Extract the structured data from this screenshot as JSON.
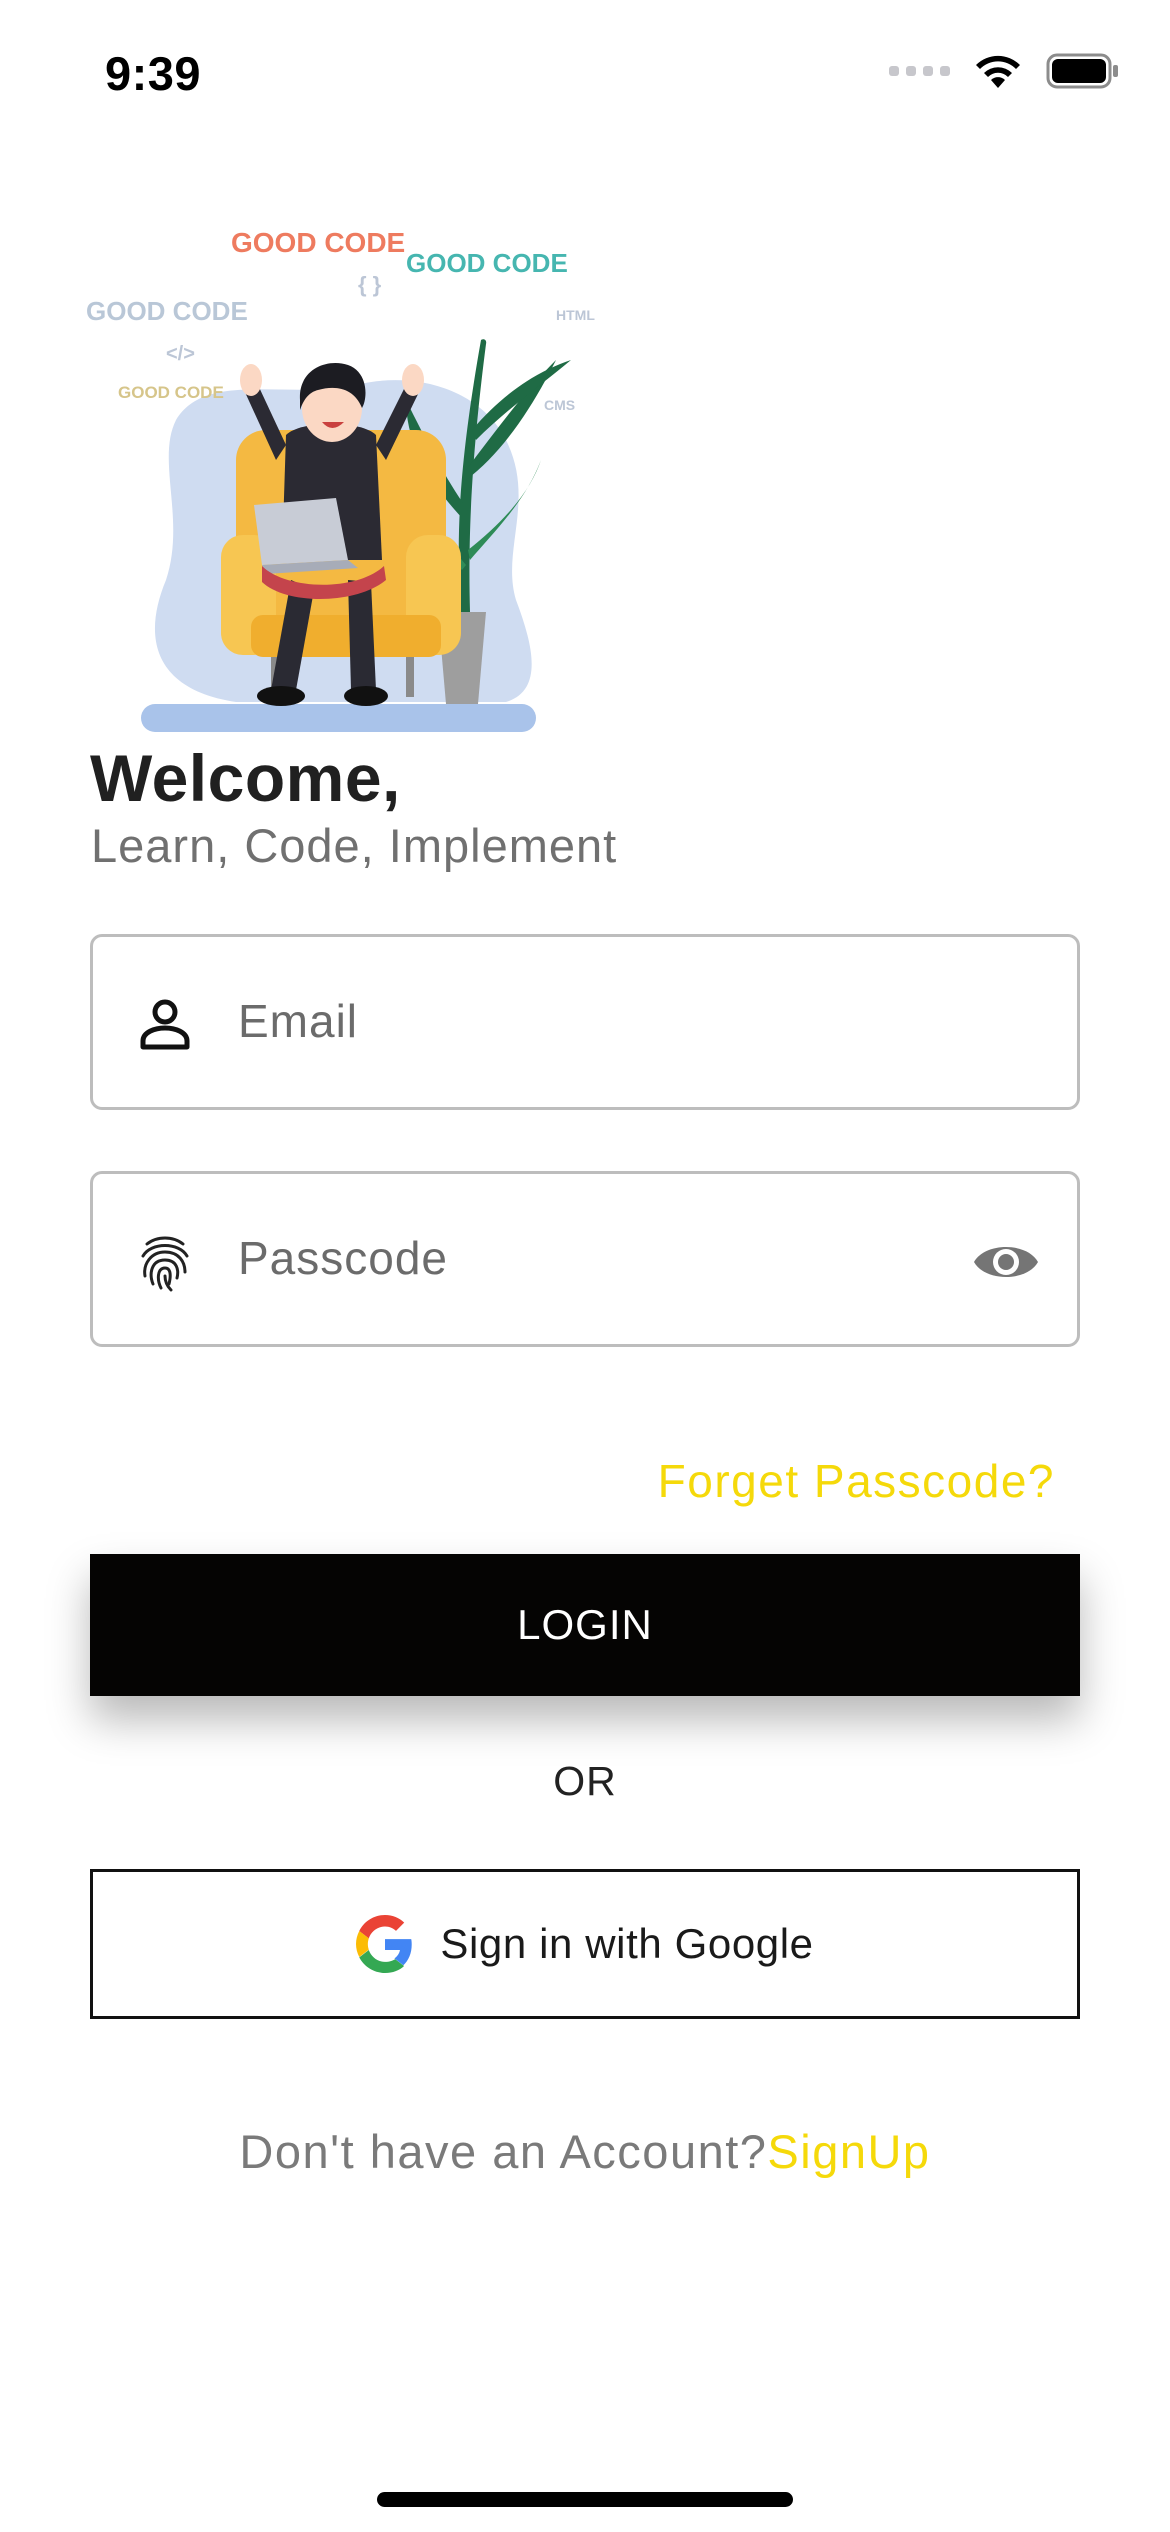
{
  "status_bar": {
    "time": "9:39"
  },
  "illustration": {
    "alt": "person-with-laptop-illustration",
    "code_words": [
      "GOOD CODE",
      "GOOD CODE",
      "GOOD CODE",
      "GOOD CODE",
      "{ }",
      "</>",
      "HTML",
      "CMS"
    ]
  },
  "header": {
    "title": "Welcome,",
    "subtitle": "Learn, Code, Implement"
  },
  "form": {
    "email_placeholder": "Email",
    "passcode_placeholder": "Passcode",
    "forgot_label": "Forget Passcode?",
    "login_label": "LOGIN",
    "or_label": "OR",
    "google_label": "Sign in with Google"
  },
  "footer": {
    "prompt": "Don't have an Account?",
    "signup_label": "SignUp"
  },
  "colors": {
    "accent": "#f5d90a",
    "button_bg": "#050403",
    "border": "#bdbdbd"
  },
  "icons": [
    "person-icon",
    "fingerprint-icon",
    "eye-icon",
    "google-g-icon",
    "wifi-icon",
    "battery-icon",
    "signal-icon"
  ]
}
